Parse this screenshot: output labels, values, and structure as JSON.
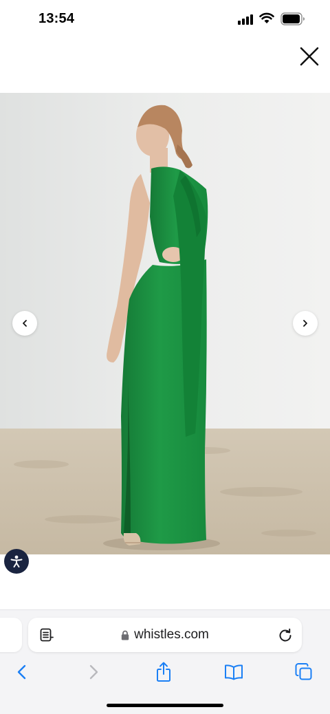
{
  "status_bar": {
    "time": "13:54",
    "icons": [
      "cellular-signal-icon",
      "wifi-icon",
      "battery-icon"
    ]
  },
  "close_bar": {
    "close_icon": "close-icon"
  },
  "product": {
    "image_alt": "Model wearing green maxi dress with tie back",
    "dress_color": "#1f9a47",
    "prev_icon": "chevron-left-icon",
    "next_icon": "chevron-right-icon"
  },
  "accessibility": {
    "icon": "accessibility-icon",
    "color": "#1a2440"
  },
  "browser": {
    "url": "whistles.com",
    "reader_icon": "page-menu-icon",
    "lock_icon": "lock-icon",
    "reload_icon": "reload-icon",
    "accent": "#1a7ff5",
    "toolbar": [
      "back-icon",
      "forward-icon",
      "share-icon",
      "bookmarks-icon",
      "tabs-icon"
    ]
  }
}
